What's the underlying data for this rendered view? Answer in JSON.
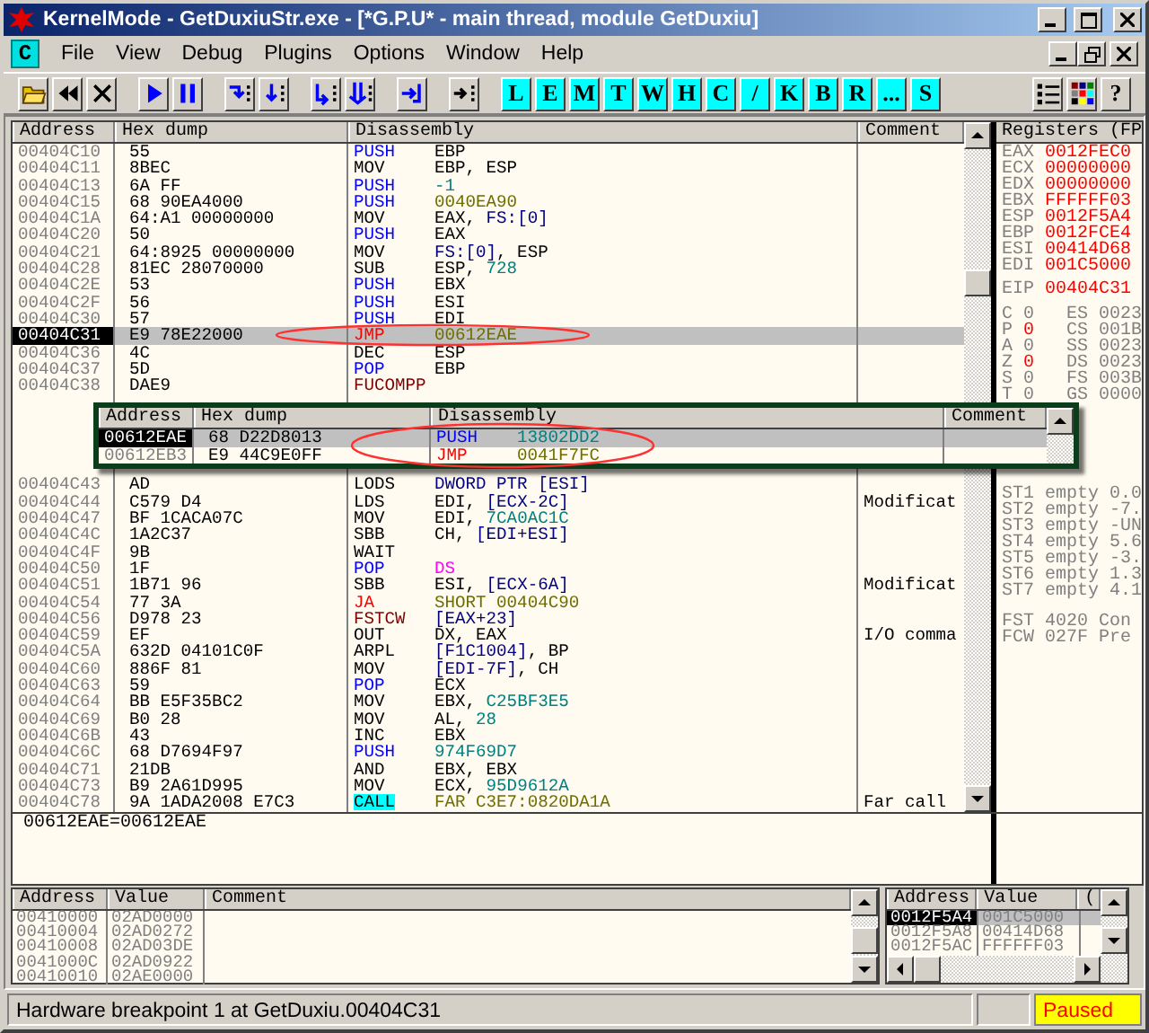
{
  "window": {
    "title": "KernelMode - GetDuxiuStr.exe - [*G.P.U* - main thread, module GetDuxiu]"
  },
  "menu": {
    "badge": "C",
    "items": [
      "File",
      "View",
      "Debug",
      "Plugins",
      "Options",
      "Window",
      "Help"
    ]
  },
  "toolbar": {
    "groups": [
      [
        {
          "kind": "icon"
        },
        {
          "kind": "icon"
        },
        {
          "kind": "icon"
        }
      ],
      [
        {
          "kind": "icon"
        },
        {
          "kind": "icon"
        }
      ],
      [
        {
          "kind": "icon"
        },
        {
          "kind": "icon"
        }
      ],
      [
        {
          "kind": "icon"
        },
        {
          "kind": "icon"
        }
      ],
      [
        {
          "kind": "icon"
        }
      ],
      [
        {
          "kind": "icon"
        }
      ],
      [
        {
          "kind": "letter",
          "label": "L"
        },
        {
          "kind": "letter",
          "label": "E"
        },
        {
          "kind": "letter",
          "label": "M"
        },
        {
          "kind": "letter",
          "label": "T"
        },
        {
          "kind": "letter",
          "label": "W"
        },
        {
          "kind": "letter",
          "label": "H"
        },
        {
          "kind": "letter",
          "label": "C"
        },
        {
          "kind": "letter",
          "label": "/"
        },
        {
          "kind": "letter",
          "label": "K"
        },
        {
          "kind": "letter",
          "label": "B"
        },
        {
          "kind": "letter",
          "label": "R"
        },
        {
          "kind": "letter",
          "label": "..."
        },
        {
          "kind": "letter",
          "label": "S"
        }
      ],
      [
        {
          "kind": "icon"
        },
        {
          "kind": "icon"
        },
        {
          "kind": "help",
          "label": "?"
        }
      ]
    ]
  },
  "disassembly": {
    "columns": [
      "Address",
      "Hex dump",
      "Disassembly",
      "Comment"
    ],
    "rows_top": [
      {
        "address": "00404C10",
        "hex": "55",
        "mnemonic": "PUSH",
        "kind": "stack",
        "operands": [
          {
            "text": "EBP",
            "kind": "plain"
          }
        ],
        "selected": false
      },
      {
        "address": "00404C11",
        "hex": "8BEC",
        "mnemonic": "MOV",
        "kind": "plain",
        "operands": [
          {
            "text": "EBP, ESP",
            "kind": "plain"
          }
        ],
        "selected": false
      },
      {
        "address": "00404C13",
        "hex": "6A FF",
        "mnemonic": "PUSH",
        "kind": "stack",
        "operands": [
          {
            "text": "-1",
            "kind": "const"
          }
        ],
        "selected": false
      },
      {
        "address": "00404C15",
        "hex": "68 90EA4000",
        "mnemonic": "PUSH",
        "kind": "stack",
        "operands": [
          {
            "text": "0040EA90",
            "kind": "addr"
          }
        ],
        "selected": false
      },
      {
        "address": "00404C1A",
        "hex": "64:A1 00000000",
        "mnemonic": "MOV",
        "kind": "plain",
        "operands": [
          {
            "text": "EAX, ",
            "kind": "plain"
          },
          {
            "text": "FS:[0]",
            "kind": "mem"
          }
        ],
        "selected": false
      },
      {
        "address": "00404C20",
        "hex": "50",
        "mnemonic": "PUSH",
        "kind": "stack",
        "operands": [
          {
            "text": "EAX",
            "kind": "plain"
          }
        ],
        "selected": false
      },
      {
        "address": "00404C21",
        "hex": "64:8925 00000000",
        "mnemonic": "MOV",
        "kind": "plain",
        "operands": [
          {
            "text": "FS:[0]",
            "kind": "mem"
          },
          {
            "text": ", ESP",
            "kind": "plain"
          }
        ],
        "selected": false
      },
      {
        "address": "00404C28",
        "hex": "81EC 28070000",
        "mnemonic": "SUB",
        "kind": "plain",
        "operands": [
          {
            "text": "ESP, ",
            "kind": "plain"
          },
          {
            "text": "728",
            "kind": "const"
          }
        ],
        "selected": false
      },
      {
        "address": "00404C2E",
        "hex": "53",
        "mnemonic": "PUSH",
        "kind": "stack",
        "operands": [
          {
            "text": "EBX",
            "kind": "plain"
          }
        ],
        "selected": false
      },
      {
        "address": "00404C2F",
        "hex": "56",
        "mnemonic": "PUSH",
        "kind": "stack",
        "operands": [
          {
            "text": "ESI",
            "kind": "plain"
          }
        ],
        "selected": false
      },
      {
        "address": "00404C30",
        "hex": "57",
        "mnemonic": "PUSH",
        "kind": "stack",
        "operands": [
          {
            "text": "EDI",
            "kind": "plain"
          }
        ],
        "selected": false
      },
      {
        "address": "00404C31",
        "hex": "E9 78E22000",
        "mnemonic": "JMP",
        "kind": "jump",
        "operands": [
          {
            "text": "00612EAE",
            "kind": "addr"
          }
        ],
        "selected": true,
        "circled": true
      },
      {
        "address": "00404C36",
        "hex": "4C",
        "mnemonic": "DEC",
        "kind": "plain",
        "operands": [
          {
            "text": "ESP",
            "kind": "plain"
          }
        ],
        "selected": false
      },
      {
        "address": "00404C37",
        "hex": "5D",
        "mnemonic": "POP",
        "kind": "stack",
        "operands": [
          {
            "text": "EBP",
            "kind": "plain"
          }
        ],
        "selected": false
      },
      {
        "address": "00404C38",
        "hex": "DAE9",
        "mnemonic": "FUCOMPP",
        "kind": "fpu",
        "selected": false
      }
    ],
    "rows_bottom": [
      {
        "address": "00404C43",
        "hex": "AD",
        "mnemonic": "LODS",
        "kind": "plain",
        "operands": [
          {
            "text": "DWORD PTR [ESI]",
            "kind": "mem"
          }
        ],
        "selected": false
      },
      {
        "address": "00404C44",
        "hex": "C579 D4",
        "mnemonic": "LDS",
        "kind": "plain",
        "operands": [
          {
            "text": "EDI, ",
            "kind": "plain"
          },
          {
            "text": "[ECX-2C]",
            "kind": "mem"
          }
        ],
        "comment": "Modificat",
        "selected": false
      },
      {
        "address": "00404C47",
        "hex": "BF 1CACA07C",
        "mnemonic": "MOV",
        "kind": "plain",
        "operands": [
          {
            "text": "EDI, ",
            "kind": "plain"
          },
          {
            "text": "7CA0AC1C",
            "kind": "const"
          }
        ],
        "selected": false
      },
      {
        "address": "00404C4C",
        "hex": "1A2C37",
        "mnemonic": "SBB",
        "kind": "plain",
        "operands": [
          {
            "text": "CH, ",
            "kind": "plain"
          },
          {
            "text": "[EDI+ESI]",
            "kind": "mem"
          }
        ],
        "selected": false
      },
      {
        "address": "00404C4F",
        "hex": "9B",
        "mnemonic": "WAIT",
        "kind": "plain",
        "selected": false
      },
      {
        "address": "00404C50",
        "hex": "1F",
        "mnemonic": "POP",
        "kind": "stack",
        "operands": [
          {
            "text": "DS",
            "kind": "seg"
          }
        ],
        "selected": false
      },
      {
        "address": "00404C51",
        "hex": "1B71 96",
        "mnemonic": "SBB",
        "kind": "plain",
        "operands": [
          {
            "text": "ESI, ",
            "kind": "plain"
          },
          {
            "text": "[ECX-6A]",
            "kind": "mem"
          }
        ],
        "comment": "Modificat",
        "selected": false
      },
      {
        "address": "00404C54",
        "hex": "77 3A",
        "mnemonic": "JA",
        "kind": "jump",
        "operands": [
          {
            "text": "SHORT 00404C90",
            "kind": "addr"
          }
        ],
        "selected": false
      },
      {
        "address": "00404C56",
        "hex": "D978 23",
        "mnemonic": "FSTCW",
        "kind": "fpu",
        "operands": [
          {
            "text": "[EAX+23]",
            "kind": "mem"
          }
        ],
        "selected": false
      },
      {
        "address": "00404C59",
        "hex": "EF",
        "mnemonic": "OUT",
        "kind": "plain",
        "operands": [
          {
            "text": "DX, EAX",
            "kind": "plain"
          }
        ],
        "comment": "I/O comma",
        "selected": false
      },
      {
        "address": "00404C5A",
        "hex": "632D 04101C0F",
        "mnemonic": "ARPL",
        "kind": "plain",
        "operands": [
          {
            "text": "[F1C1004]",
            "kind": "mem"
          },
          {
            "text": ", BP",
            "kind": "plain"
          }
        ],
        "selected": false
      },
      {
        "address": "00404C60",
        "hex": "886F 81",
        "mnemonic": "MOV",
        "kind": "plain",
        "operands": [
          {
            "text": "[EDI-7F]",
            "kind": "mem"
          },
          {
            "text": ", CH",
            "kind": "plain"
          }
        ],
        "selected": false
      },
      {
        "address": "00404C63",
        "hex": "59",
        "mnemonic": "POP",
        "kind": "stack",
        "operands": [
          {
            "text": "ECX",
            "kind": "plain"
          }
        ],
        "selected": false
      },
      {
        "address": "00404C64",
        "hex": "BB E5F35BC2",
        "mnemonic": "MOV",
        "kind": "plain",
        "operands": [
          {
            "text": "EBX, ",
            "kind": "plain"
          },
          {
            "text": "C25BF3E5",
            "kind": "const"
          }
        ],
        "selected": false
      },
      {
        "address": "00404C69",
        "hex": "B0 28",
        "mnemonic": "MOV",
        "kind": "plain",
        "operands": [
          {
            "text": "AL, ",
            "kind": "plain"
          },
          {
            "text": "28",
            "kind": "const"
          }
        ],
        "selected": false
      },
      {
        "address": "00404C6B",
        "hex": "43",
        "mnemonic": "INC",
        "kind": "plain",
        "operands": [
          {
            "text": "EBX",
            "kind": "plain"
          }
        ],
        "selected": false
      },
      {
        "address": "00404C6C",
        "hex": "68 D7694F97",
        "mnemonic": "PUSH",
        "kind": "stack",
        "operands": [
          {
            "text": "974F69D7",
            "kind": "const"
          }
        ],
        "selected": false
      },
      {
        "address": "00404C71",
        "hex": "21DB",
        "mnemonic": "AND",
        "kind": "plain",
        "operands": [
          {
            "text": "EBX, EBX",
            "kind": "plain"
          }
        ],
        "selected": false
      },
      {
        "address": "00404C73",
        "hex": "B9 2A61D995",
        "mnemonic": "MOV",
        "kind": "plain",
        "operands": [
          {
            "text": "ECX, ",
            "kind": "plain"
          },
          {
            "text": "95D9612A",
            "kind": "const"
          }
        ],
        "selected": false
      },
      {
        "address": "00404C78",
        "hex": "9A 1ADA2008 E7C3",
        "mnemonic": "CALL",
        "kind": "call",
        "operands": [
          {
            "text": "FAR C3E7:0820DA1A",
            "kind": "addr"
          }
        ],
        "comment": "Far call",
        "selected": false
      }
    ]
  },
  "popup": {
    "columns": [
      "Address",
      "Hex dump",
      "Disassembly",
      "Comment"
    ],
    "rows": [
      {
        "address": "00612EAE",
        "hex": "68 D22D8013",
        "mnemonic": "PUSH",
        "kind": "stack",
        "operands": [
          {
            "text": "13802DD2",
            "kind": "const"
          }
        ],
        "selected": true
      },
      {
        "address": "00612EB3",
        "hex": "E9 44C9E0FF",
        "mnemonic": "JMP",
        "kind": "jump",
        "operands": [
          {
            "text": "0041F7FC",
            "kind": "addr"
          }
        ],
        "selected": false
      }
    ]
  },
  "registers": {
    "title": "Registers (FP",
    "general": [
      {
        "name": "EAX",
        "value": "0012FEC0",
        "changed": true
      },
      {
        "name": "ECX",
        "value": "00000000",
        "changed": true
      },
      {
        "name": "EDX",
        "value": "00000000",
        "changed": true
      },
      {
        "name": "EBX",
        "value": "FFFFFF03",
        "changed": true
      },
      {
        "name": "ESP",
        "value": "0012F5A4",
        "changed": true
      },
      {
        "name": "EBP",
        "value": "0012FCE4",
        "changed": true
      },
      {
        "name": "ESI",
        "value": "00414D68",
        "changed": true
      },
      {
        "name": "EDI",
        "value": "001C5000",
        "changed": true
      }
    ],
    "eip": {
      "name": "EIP",
      "value": "00404C31",
      "changed": true
    },
    "flags": [
      {
        "name": "C",
        "value": "0",
        "changed": false,
        "segment": "ES",
        "segment_value": "0023"
      },
      {
        "name": "P",
        "value": "0",
        "changed": true,
        "segment": "CS",
        "segment_value": "001B"
      },
      {
        "name": "A",
        "value": "0",
        "changed": false,
        "segment": "SS",
        "segment_value": "0023"
      },
      {
        "name": "Z",
        "value": "0",
        "changed": true,
        "segment": "DS",
        "segment_value": "0023"
      },
      {
        "name": "S",
        "value": "0",
        "changed": false,
        "segment": "FS",
        "segment_value": "003B"
      },
      {
        "name": "T",
        "value": "0",
        "changed": false,
        "segment": "GS",
        "segment_value": "0000"
      }
    ],
    "fpu": [
      {
        "name": "ST1",
        "tag": "empty",
        "value": "0.0"
      },
      {
        "name": "ST2",
        "tag": "empty",
        "value": "-7."
      },
      {
        "name": "ST3",
        "tag": "empty",
        "value": "-UN"
      },
      {
        "name": "ST4",
        "tag": "empty",
        "value": "5.6"
      },
      {
        "name": "ST5",
        "tag": "empty",
        "value": "-3."
      },
      {
        "name": "ST6",
        "tag": "empty",
        "value": "1.3"
      },
      {
        "name": "ST7",
        "tag": "empty",
        "value": "4.1"
      }
    ],
    "fpu_status": [
      {
        "name": "FST",
        "value": "4020",
        "note": "Con"
      },
      {
        "name": "FCW",
        "value": "027F",
        "note": "Pre"
      }
    ]
  },
  "info_line": "00612EAE=00612EAE",
  "dump": {
    "columns": [
      "Address",
      "Value",
      "Comment"
    ],
    "rows": [
      {
        "address": "00410000",
        "value": "02AD0000"
      },
      {
        "address": "00410004",
        "value": "02AD0272"
      },
      {
        "address": "00410008",
        "value": "02AD03DE"
      },
      {
        "address": "0041000C",
        "value": "02AD0922"
      },
      {
        "address": "00410010",
        "value": "02AE0000"
      }
    ]
  },
  "stack": {
    "columns": [
      "Address",
      "Value",
      "("
    ],
    "rows": [
      {
        "address": "0012F5A4",
        "value": "001C5000",
        "selected": true
      },
      {
        "address": "0012F5A8",
        "value": "00414D68",
        "selected": false
      },
      {
        "address": "0012F5AC",
        "value": "FFFFFF03",
        "selected": false
      }
    ]
  },
  "status_bar": {
    "message": "Hardware breakpoint 1 at GetDuxiu.00404C31",
    "state": "Paused"
  }
}
